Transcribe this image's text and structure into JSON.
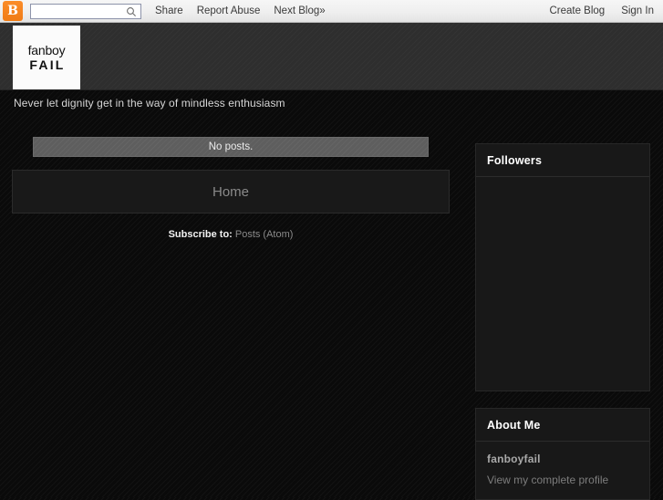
{
  "navbar": {
    "logo_icon": "blogger-b-icon",
    "logo_letter": "B",
    "search": {
      "value": "",
      "placeholder": "",
      "icon": "search-icon"
    },
    "links": [
      {
        "label": "Share"
      },
      {
        "label": "Report Abuse"
      },
      {
        "label": "Next Blog»"
      }
    ],
    "right_links": [
      {
        "label": "Create Blog"
      },
      {
        "label": "Sign In"
      }
    ]
  },
  "header": {
    "logo": {
      "line1": "fanboy",
      "line2": "FAIL"
    },
    "tagline": "Never let dignity get in the way of mindless enthusiasm"
  },
  "main": {
    "no_posts": "No posts.",
    "home_label": "Home",
    "subscribe": {
      "label": "Subscribe to:",
      "link": "Posts (Atom)"
    }
  },
  "sidebar": {
    "followers": {
      "title": "Followers"
    },
    "about": {
      "title": "About Me",
      "profile_name": "fanboyfail",
      "profile_link": "View my complete profile"
    }
  },
  "colors": {
    "page_background": "#0a0a0a",
    "header_band": "#2e2e2e",
    "navbar_background": "#efefef",
    "blogger_orange": "#f07c16",
    "widget_background": "#181818",
    "no_posts_bar": "#5e5e5e",
    "link_gray": "#8a8a8a"
  }
}
